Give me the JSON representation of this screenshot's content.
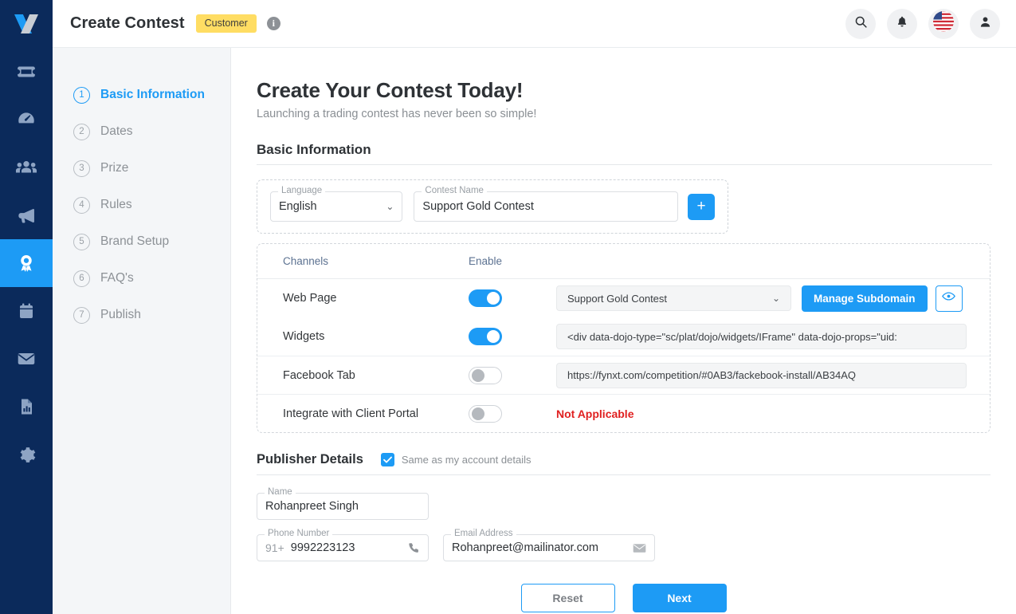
{
  "brand": {
    "logo_icon": "x-logo-icon",
    "logo_colors": [
      "#1d9bf5",
      "#c8cdd4"
    ]
  },
  "colors": {
    "accent": "#1d9bf5",
    "sidebar": "#0b2a5b",
    "badge": "#ffdd63",
    "danger": "#e02020",
    "panel": "#f4f6f8"
  },
  "topbar": {
    "title": "Create Contest",
    "badge": "Customer",
    "info_icon": "info-icon",
    "actions": [
      {
        "icon": "search-icon",
        "name": "search-button"
      },
      {
        "icon": "bell-icon",
        "name": "notifications-button"
      },
      {
        "icon": "flag-us-icon",
        "name": "language-flag-button"
      },
      {
        "icon": "user-icon",
        "name": "account-button"
      }
    ]
  },
  "rail": {
    "items": [
      {
        "icon": "ticket-icon",
        "active": false
      },
      {
        "icon": "speedometer-icon",
        "active": false
      },
      {
        "icon": "users-icon",
        "active": false
      },
      {
        "icon": "megaphone-icon",
        "active": false
      },
      {
        "icon": "award-icon",
        "active": true
      },
      {
        "icon": "calendar-icon",
        "active": false
      },
      {
        "icon": "envelope-icon",
        "active": false
      },
      {
        "icon": "report-icon",
        "active": false
      },
      {
        "icon": "gear-icon",
        "active": false
      }
    ]
  },
  "steps": [
    {
      "num": "1",
      "label": "Basic Information",
      "active": true
    },
    {
      "num": "2",
      "label": "Dates",
      "active": false
    },
    {
      "num": "3",
      "label": "Prize",
      "active": false
    },
    {
      "num": "4",
      "label": "Rules",
      "active": false
    },
    {
      "num": "5",
      "label": "Brand Setup",
      "active": false
    },
    {
      "num": "6",
      "label": "FAQ's",
      "active": false
    },
    {
      "num": "7",
      "label": "Publish",
      "active": false
    }
  ],
  "main": {
    "page_title": "Create Your Contest Today!",
    "page_subtitle": "Launching a trading contest has never been so simple!",
    "section_title": "Basic Information",
    "language": {
      "label": "Language",
      "value": "English",
      "caret_icon": "chevron-down-icon"
    },
    "contest_name": {
      "label": "Contest Name",
      "value": "Support Gold Contest",
      "placeholder": "Contest Name"
    },
    "add_button": {
      "icon": "plus-icon",
      "label": "+"
    }
  },
  "channels": {
    "header": {
      "channels": "Channels",
      "enable": "Enable"
    },
    "rows": [
      {
        "name": "Web Page",
        "enabled": true,
        "select_value": "Support Gold Contest",
        "button_label": "Manage Subdomain",
        "eye_icon": "eye-icon"
      },
      {
        "name": "Widgets",
        "enabled": true,
        "code_value": "<div data-dojo-type=\"sc/plat/dojo/widgets/IFrame\" data-dojo-props=\"uid:"
      },
      {
        "name": "Facebook Tab",
        "enabled": false,
        "url_value": "https://fynxt.com/competition/#0AB3/fackebook-install/AB34AQ"
      },
      {
        "name": "Integrate with Client Portal",
        "enabled": false,
        "status_text": "Not Applicable"
      }
    ]
  },
  "publisher": {
    "title": "Publisher Details",
    "same_as_account_label": "Same as my account details",
    "same_as_account_checked": true,
    "check_icon": "check-icon",
    "name": {
      "label": "Name",
      "value": "Rohanpreet Singh"
    },
    "phone": {
      "label": "Phone Number",
      "country_code": "91+",
      "value": "9992223123",
      "icon": "phone-icon"
    },
    "email": {
      "label": "Email Address",
      "value": "Rohanpreet@mailinator.com",
      "icon": "mail-icon"
    }
  },
  "footer": {
    "reset_label": "Reset",
    "next_label": "Next"
  }
}
